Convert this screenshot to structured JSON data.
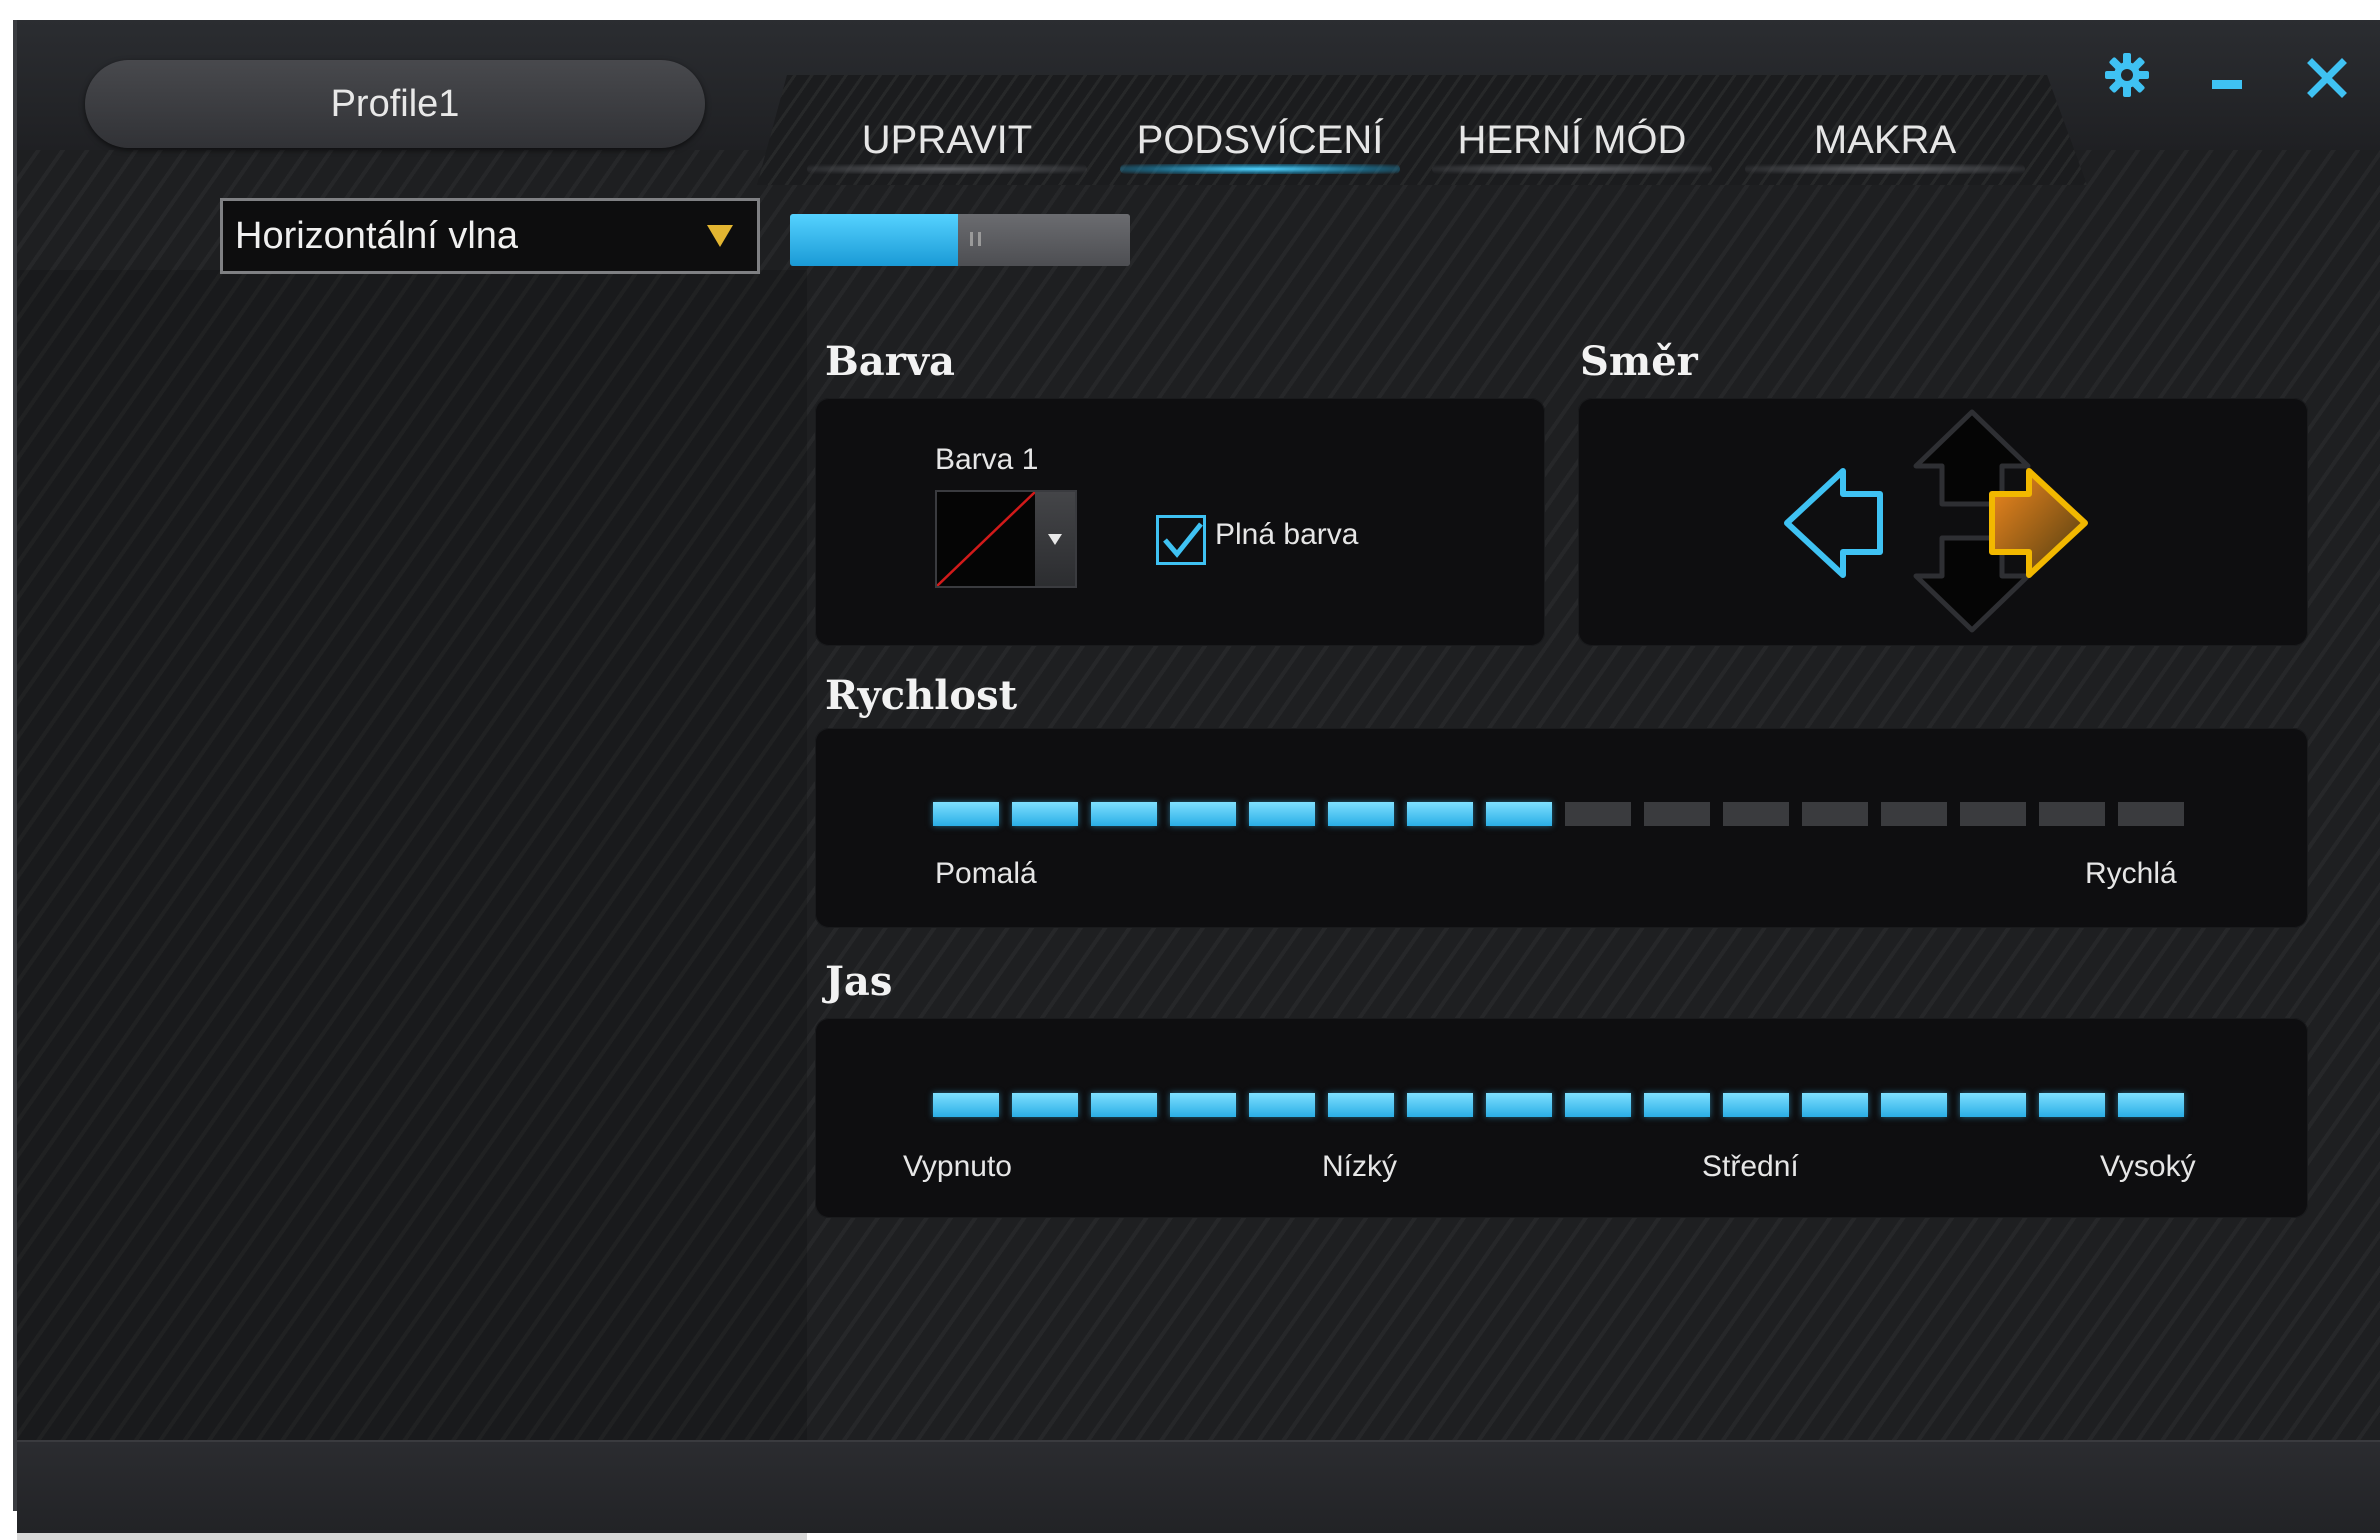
{
  "profile": {
    "name": "Profile1"
  },
  "tabs": [
    {
      "label": "UPRAVIT",
      "active": false
    },
    {
      "label": "PODSVÍCENÍ",
      "active": true
    },
    {
      "label": "HERNÍ MÓD",
      "active": false
    },
    {
      "label": "MAKRA",
      "active": false
    }
  ],
  "window_controls": {
    "settings_icon": "gear-icon",
    "minimize_icon": "minimize-icon",
    "close_icon": "close-icon"
  },
  "effect_select": {
    "value": "Horizontální vlna"
  },
  "lighting_toggle": {
    "state": "on"
  },
  "color_section": {
    "title": "Barva",
    "color1_label": "Barva 1",
    "solid_color_label": "Plná barva",
    "solid_color_checked": true
  },
  "direction_section": {
    "title": "Směr",
    "arrows": [
      "left",
      "up",
      "down",
      "right"
    ],
    "left_color": "#3fc2f3",
    "right_color": "#f2b800"
  },
  "speed_section": {
    "title": "Rychlost",
    "segments_total": 16,
    "level": 8,
    "labels": {
      "min": "Pomalá",
      "max": "Rychlá"
    }
  },
  "brightness_section": {
    "title": "Jas",
    "segments_total": 16,
    "level": 16,
    "labels": {
      "off": "Vypnuto",
      "low": "Nízký",
      "mid": "Střední",
      "high": "Vysoký"
    }
  },
  "colors": {
    "accent": "#3fc2f3",
    "dropdown_arrow": "#e3b531",
    "inactive_segment": "#3a3b3e"
  }
}
